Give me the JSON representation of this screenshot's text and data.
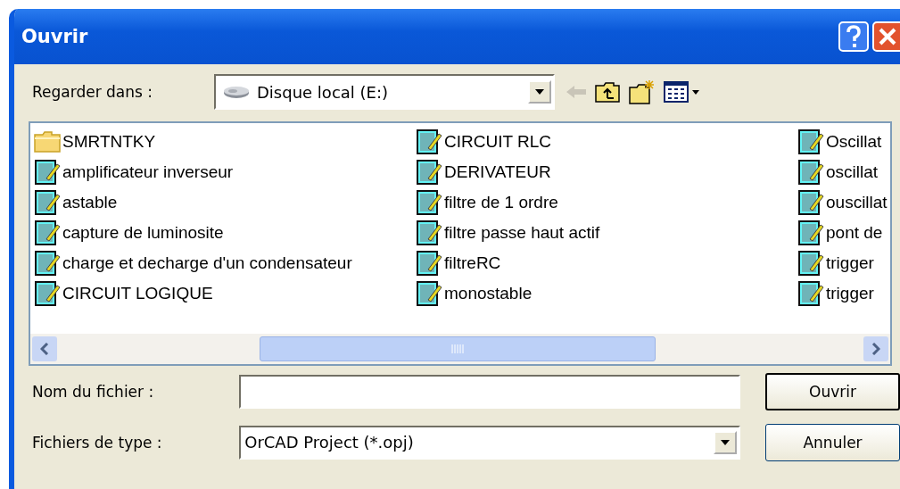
{
  "window": {
    "title": "Ouvrir"
  },
  "look_in": {
    "label": "Regarder dans :",
    "value": "Disque local (E:)"
  },
  "files": [
    {
      "name": "SMRTNTKY",
      "kind": "folder"
    },
    {
      "name": "amplificateur inverseur",
      "kind": "file"
    },
    {
      "name": "astable",
      "kind": "file"
    },
    {
      "name": "capture de luminosite",
      "kind": "file"
    },
    {
      "name": "charge et decharge d'un condensateur",
      "kind": "file"
    },
    {
      "name": "CIRCUIT LOGIQUE",
      "kind": "file"
    },
    {
      "name": "CIRCUIT RLC",
      "kind": "file"
    },
    {
      "name": "DERIVATEUR",
      "kind": "file"
    },
    {
      "name": "filtre de 1 ordre",
      "kind": "file"
    },
    {
      "name": "filtre passe haut actif",
      "kind": "file"
    },
    {
      "name": "filtreRC",
      "kind": "file"
    },
    {
      "name": "monostable",
      "kind": "file"
    },
    {
      "name": "Oscillat",
      "kind": "file"
    },
    {
      "name": "oscillat",
      "kind": "file"
    },
    {
      "name": "ouscillat",
      "kind": "file"
    },
    {
      "name": "pont de",
      "kind": "file"
    },
    {
      "name": "trigger",
      "kind": "file"
    },
    {
      "name": "trigger",
      "kind": "file"
    }
  ],
  "file_name": {
    "label": "Nom du fichier :"
  },
  "file_type": {
    "label": "Fichiers de type :",
    "value": "OrCAD Project (*.opj)"
  },
  "buttons": [
    {
      "label": "Ouvrir",
      "default": true
    },
    {
      "label": "Annuler",
      "default": false
    }
  ]
}
